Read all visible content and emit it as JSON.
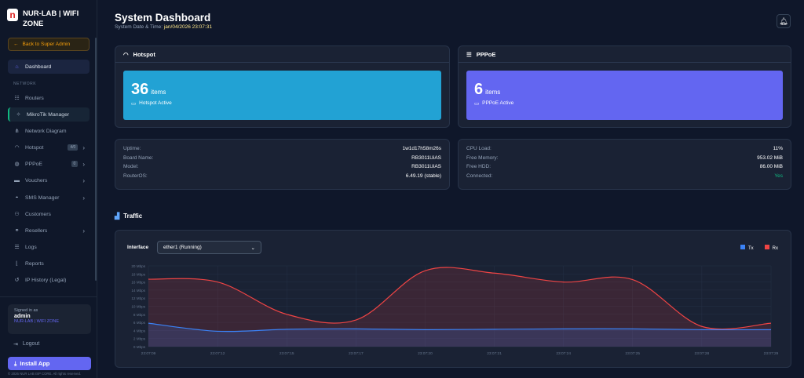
{
  "brand": {
    "name": "NUR-LAB | WIFI ZONE",
    "logo_letter": "n"
  },
  "sidebar": {
    "back": "Back to Super Admin",
    "section": "NETWORK",
    "items": [
      {
        "label": "Dashboard",
        "icon": "home-icon"
      },
      {
        "label": "Routers",
        "icon": "sitemap-icon"
      },
      {
        "label": "MikroTik Manager",
        "icon": "satellite-icon"
      },
      {
        "label": "Network Diagram",
        "icon": "diagram-icon"
      },
      {
        "label": "Hotspot",
        "icon": "wifi-icon",
        "badge": "4/0"
      },
      {
        "label": "PPPoE",
        "icon": "globe-icon",
        "badge": "0"
      },
      {
        "label": "Vouchers",
        "icon": "ticket-icon"
      },
      {
        "label": "SMS Manager",
        "icon": "sms-icon"
      },
      {
        "label": "Customers",
        "icon": "users-icon"
      },
      {
        "label": "Resellers",
        "icon": "handshake-icon"
      },
      {
        "label": "Logs",
        "icon": "database-icon"
      },
      {
        "label": "Reports",
        "icon": "chart-icon"
      },
      {
        "label": "IP History (Legal)",
        "icon": "history-icon"
      }
    ],
    "signed_in_label": "Signed in as",
    "user": "admin",
    "org": "NUR-LAB | WIFI ZONE",
    "logout": "Logout",
    "install": "Install App",
    "copyright": "© 2026 NUR LAB ISP CORE. All rights reserved."
  },
  "header": {
    "title": "System Dashboard",
    "datetime_label": "System Date & Time:",
    "datetime": "jan/04/2026 23:07:31"
  },
  "hotspot": {
    "title": "Hotspot",
    "count": "36",
    "unit": "items",
    "status": "Hotspot Active",
    "color": "#22a2d4"
  },
  "pppoe": {
    "title": "PPPoE",
    "count": "6",
    "unit": "items",
    "status": "PPPoE Active",
    "color": "#6366f1"
  },
  "system": [
    {
      "k": "Uptime:",
      "v": "1w1d17h58m26s"
    },
    {
      "k": "Board Name:",
      "v": "RB3011UiAS"
    },
    {
      "k": "Model:",
      "v": "RB3011UiAS"
    },
    {
      "k": "RouterOS:",
      "v": "6.49.19 (stable)"
    }
  ],
  "resources": [
    {
      "k": "CPU Load:",
      "v": "11%"
    },
    {
      "k": "Free Memory:",
      "v": "953.02 MiB"
    },
    {
      "k": "Free HDD:",
      "v": "86.00 MiB"
    },
    {
      "k": "Connected:",
      "v": "Yes"
    }
  ],
  "traffic": {
    "title": "Traffic",
    "interface_label": "Interface",
    "interface": "ether1 (Running)"
  },
  "chart_data": {
    "type": "area",
    "x": [
      "23:07:09",
      "23:07:12",
      "23:07:15",
      "23:07:17",
      "23:07:20",
      "23:07:21",
      "23:07:24",
      "23:07:25",
      "23:07:28",
      "23:07:29"
    ],
    "yticks": [
      "0 Mbps",
      "2 Mbps",
      "4 Mbps",
      "6 Mbps",
      "8 Mbps",
      "10 Mbps",
      "12 Mbps",
      "14 Mbps",
      "16 Mbps",
      "18 Mbps",
      "20 Mbps"
    ],
    "ylim": [
      0,
      20
    ],
    "grid": true,
    "legend": "top-right",
    "series": [
      {
        "name": "Tx",
        "color": "#3b82f6",
        "values": [
          5.8,
          3.8,
          4.3,
          4.4,
          4.2,
          4.3,
          4.4,
          4.4,
          4.2,
          4.2
        ]
      },
      {
        "name": "Rx",
        "color": "#ef4444",
        "values": [
          16.7,
          16.0,
          8.0,
          6.6,
          18.8,
          18.2,
          16.0,
          16.6,
          5.0,
          5.8
        ]
      }
    ]
  }
}
